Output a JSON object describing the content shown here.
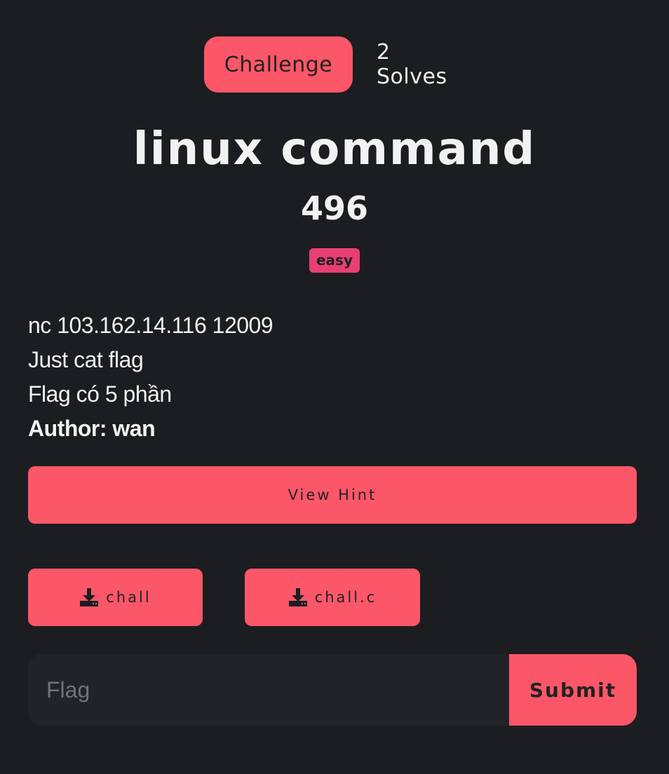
{
  "tabs": {
    "challenge": "Challenge",
    "solves": "2 Solves"
  },
  "challenge": {
    "name": "linux command",
    "points": "496",
    "difficulty": "easy",
    "description": {
      "line1": "nc 103.162.14.116 12009",
      "line2": "Just cat flag",
      "line3": "Flag có 5 phần",
      "author": "Author: wan"
    }
  },
  "buttons": {
    "view_hint": "View Hint",
    "files": [
      {
        "label": "chall",
        "icon": "download-icon"
      },
      {
        "label": "chall.c",
        "icon": "download-icon"
      }
    ]
  },
  "flag_form": {
    "placeholder": "Flag",
    "value": "",
    "submit_label": "Submit"
  },
  "colors": {
    "background": "#1c1d20",
    "accent": "#fb5769",
    "badge": "#e83f72",
    "input_bg": "#222326"
  }
}
